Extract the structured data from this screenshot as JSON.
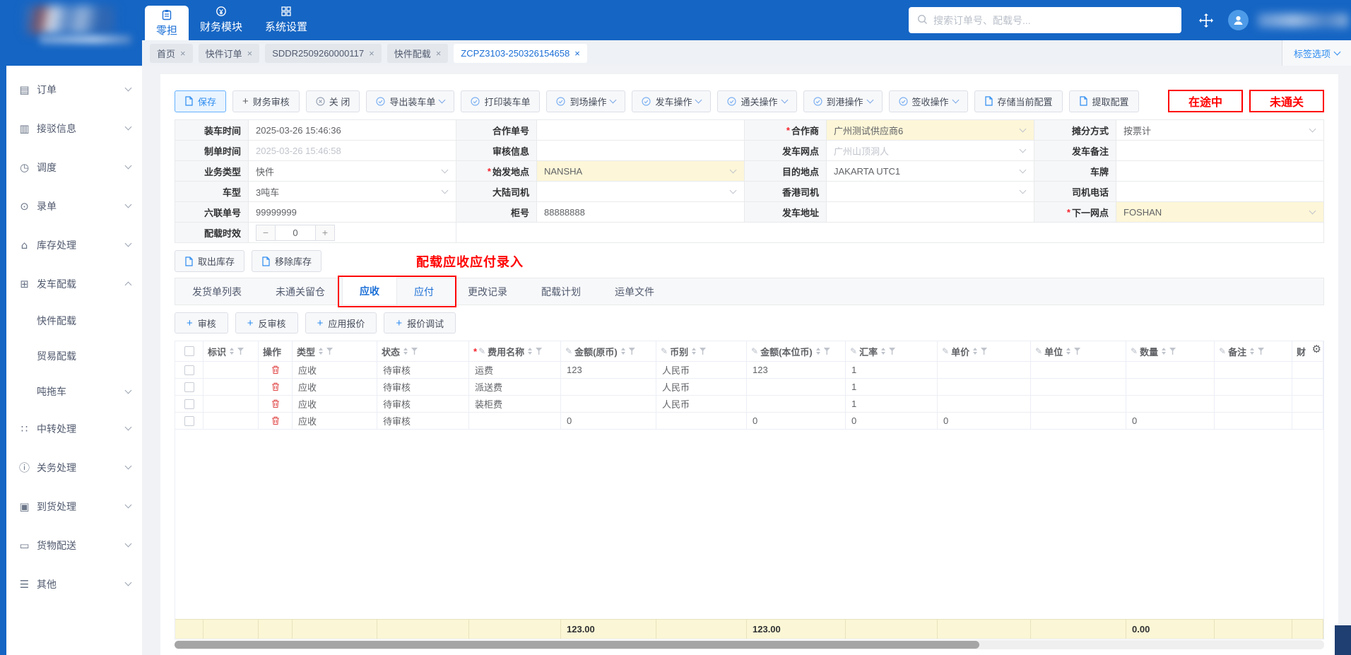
{
  "icons": {
    "edit": "✎",
    "gear": "⚙",
    "order": "▤",
    "connect": "▥",
    "dispatch": "◷",
    "entry": "⊙",
    "inventory": "⌂",
    "loading": "⊞",
    "transit": "∷",
    "customs": "ⓘ",
    "arrival": "▣",
    "delivery": "▭",
    "other": "☰",
    "close_tab": "×",
    "minus": "−",
    "plus": "+"
  },
  "topbar": {
    "search_placeholder": "搜索订单号、配载号...",
    "nav": [
      {
        "label": "零担"
      },
      {
        "label": "财务模块"
      },
      {
        "label": "系统设置"
      }
    ]
  },
  "tabbar": {
    "tabs": [
      "首页",
      "快件订单",
      "SDDR2509260000117",
      "快件配载",
      "ZCPZ3103-250326154658"
    ],
    "options": "标签选项"
  },
  "sidebar": {
    "items": [
      {
        "label": "订单"
      },
      {
        "label": "接驳信息"
      },
      {
        "label": "调度"
      },
      {
        "label": "录单"
      },
      {
        "label": "库存处理"
      },
      {
        "label": "发车配载"
      },
      {
        "label": "快件配载"
      },
      {
        "label": "贸易配载"
      },
      {
        "label": "吨拖车"
      },
      {
        "label": "中转处理"
      },
      {
        "label": "关务处理"
      },
      {
        "label": "到货处理"
      },
      {
        "label": "货物配送"
      },
      {
        "label": "其他"
      }
    ]
  },
  "toolbar": {
    "save": "保存",
    "audit": "财务审核",
    "close": "关 闭",
    "export": "导出装车单",
    "print": "打印装车单",
    "arrive": "到场操作",
    "depart": "发车操作",
    "customs": "通关操作",
    "port": "到港操作",
    "sign": "签收操作",
    "store": "存储当前配置",
    "extract": "提取配置",
    "badge_transit": "在途中",
    "badge_customs": "未通关"
  },
  "form": {
    "r1c1": "装车时间",
    "r1v1": "2025-03-26 15:46:36",
    "r1c2": "合作单号",
    "r1v2": "",
    "r1c3": "合作商",
    "r1v3": "广州测试供应商6",
    "r1c4": "摊分方式",
    "r1v4": "按票计",
    "r2c1": "制单时间",
    "r2v1": "2025-03-26 15:46:58",
    "r2c2": "审核信息",
    "r2v2": "",
    "r2c3": "发车网点",
    "r2v3": "广州山顶洞人",
    "r2c4": "发车备注",
    "r2v4": "",
    "r3c1": "业务类型",
    "r3v1": "快件",
    "r3c2": "始发地点",
    "r3v2": "NANSHA",
    "r3c3": "目的地点",
    "r3v3": "JAKARTA UTC1",
    "r3c4": "车牌",
    "r3v4": "",
    "r4c1": "车型",
    "r4v1": "3吨车",
    "r4c2": "大陆司机",
    "r4v2": "",
    "r4c3": "香港司机",
    "r4v3": "",
    "r4c4": "司机电话",
    "r4v4": "",
    "r5c1": "六联单号",
    "r5v1": "99999999",
    "r5c2": "柜号",
    "r5v2": "88888888",
    "r5c3": "发车地址",
    "r5v3": "",
    "r5c4": "下一网点",
    "r5v4": "FOSHAN",
    "r6c1": "配载时效",
    "r6v1": "0"
  },
  "stock": {
    "take": "取出库存",
    "remove": "移除库存"
  },
  "annotation": "配载应收应付录入",
  "detail_tabs": {
    "t0": "发货单列表",
    "t1": "未通关留仓",
    "t2": "应收",
    "t3": "应付",
    "t4": "更改记录",
    "t5": "配载计划",
    "t6": "运单文件"
  },
  "actions": {
    "a0": "审核",
    "a1": "反审核",
    "a2": "应用报价",
    "a3": "报价调试"
  },
  "table": {
    "columns": {
      "c1": "标识",
      "c2": "操作",
      "c3": "类型",
      "c4": "状态",
      "c5": "费用名称",
      "c6": "金额(原币)",
      "c7": "币别",
      "c8": "金额(本位币)",
      "c9": "汇率",
      "c10": "单价",
      "c11": "单位",
      "c12": "数量",
      "c13": "备注",
      "c14": "财"
    },
    "rows": [
      {
        "type": "应收",
        "status": "待审核",
        "fee": "运费",
        "amount": "123",
        "currency": "人民币",
        "amount_base": "123",
        "rate": "1",
        "price": "",
        "unit": "",
        "qty": "",
        "remark": ""
      },
      {
        "type": "应收",
        "status": "待审核",
        "fee": "派送费",
        "amount": "",
        "currency": "人民币",
        "amount_base": "",
        "rate": "1",
        "price": "",
        "unit": "",
        "qty": "",
        "remark": ""
      },
      {
        "type": "应收",
        "status": "待审核",
        "fee": "装柜费",
        "amount": "",
        "currency": "人民币",
        "amount_base": "",
        "rate": "1",
        "price": "",
        "unit": "",
        "qty": "",
        "remark": ""
      },
      {
        "type": "应收",
        "status": "待审核",
        "fee": "",
        "amount": "0",
        "currency": "",
        "amount_base": "0",
        "rate": "0",
        "price": "0",
        "unit": "",
        "qty": "0",
        "remark": ""
      }
    ],
    "footer": {
      "amount": "123.00",
      "amount_base": "123.00",
      "qty": "0.00"
    }
  }
}
